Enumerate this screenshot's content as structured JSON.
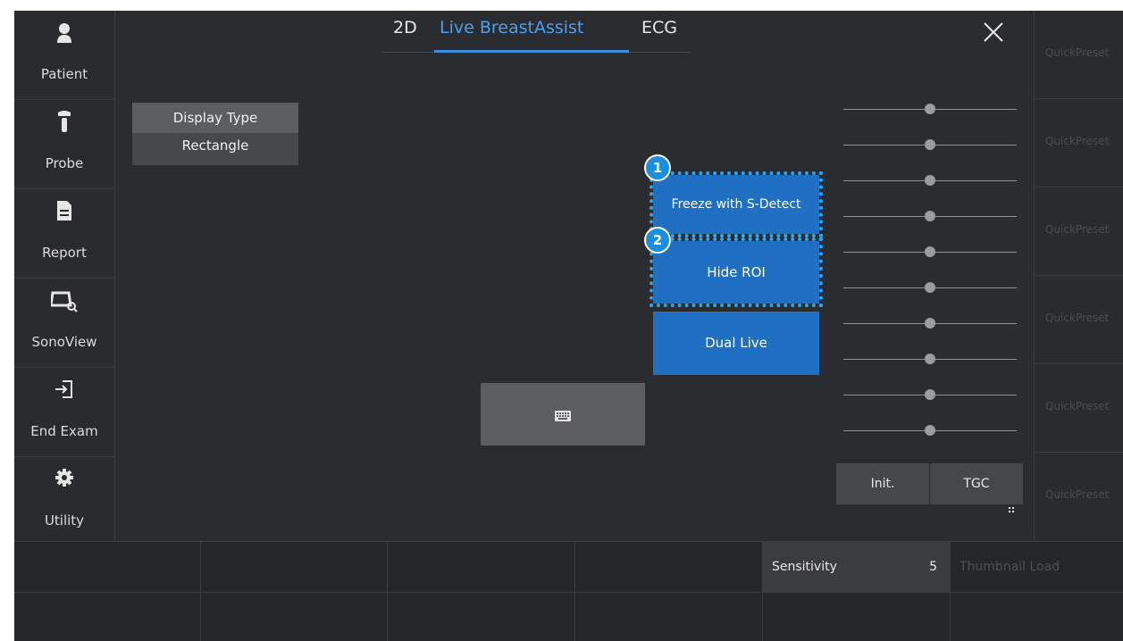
{
  "sidebar": {
    "items": [
      {
        "label": "Patient",
        "icon": "person-icon"
      },
      {
        "label": "Probe",
        "icon": "probe-icon"
      },
      {
        "label": "Report",
        "icon": "document-icon"
      },
      {
        "label": "SonoView",
        "icon": "sonoview-icon"
      },
      {
        "label": "End Exam",
        "icon": "exit-icon"
      },
      {
        "label": "Utility",
        "icon": "gear-icon"
      }
    ]
  },
  "tabs": [
    {
      "label": "2D",
      "active": false
    },
    {
      "label": "Live BreastAssist",
      "active": true
    },
    {
      "label": "ECG",
      "active": false
    }
  ],
  "display_type": {
    "title": "Display Type",
    "value": "Rectangle"
  },
  "buttons": {
    "freeze": "Freeze with S-Detect",
    "hide_roi": "Hide ROI",
    "dual_live": "Dual Live",
    "init": "Init.",
    "tgc": "TGC"
  },
  "markers": {
    "one": "1",
    "two": "2"
  },
  "quick_presets": [
    "QuickPreset",
    "QuickPreset",
    "QuickPreset",
    "QuickPreset",
    "QuickPreset",
    "QuickPreset"
  ],
  "bottom": {
    "sensitivity_label": "Sensitivity",
    "sensitivity_value": "5",
    "thumbnail_load": "Thumbnail Load"
  },
  "tgc_sliders": [
    0.5,
    0.5,
    0.5,
    0.5,
    0.5,
    0.5,
    0.5,
    0.5,
    0.5,
    0.5
  ],
  "colors": {
    "accent": "#1f6fc3",
    "highlight": "#2ba6f2",
    "active_tab": "#4aa0f0"
  }
}
